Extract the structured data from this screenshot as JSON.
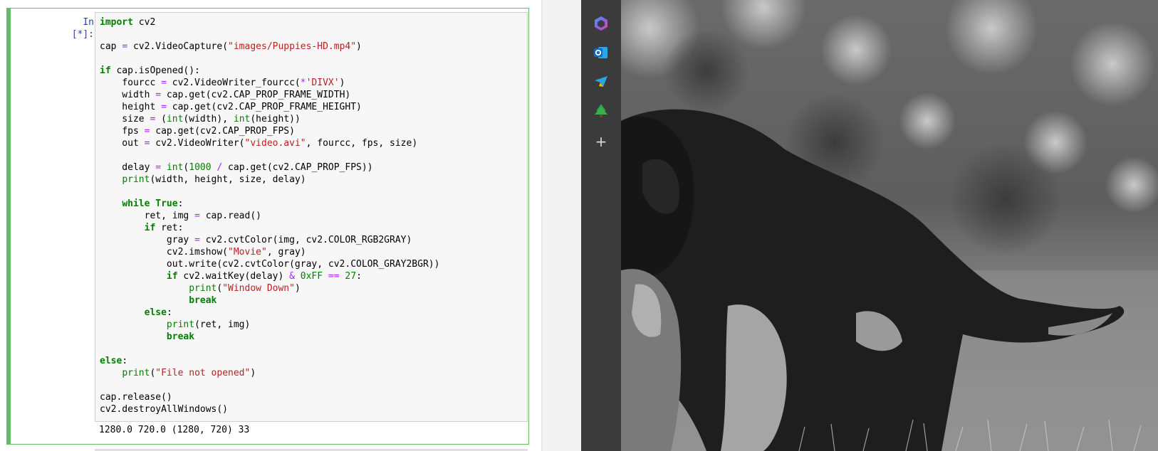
{
  "notebook": {
    "prompt": "In [*]:",
    "code_lines": [
      "import cv2",
      "",
      "cap = cv2.VideoCapture(\"images/Puppies-HD.mp4\")",
      "",
      "if cap.isOpened():",
      "    fourcc = cv2.VideoWriter_fourcc(*'DIVX')",
      "    width = cap.get(cv2.CAP_PROP_FRAME_WIDTH)",
      "    height = cap.get(cv2.CAP_PROP_FRAME_HEIGHT)",
      "    size = (int(width), int(height))",
      "    fps = cap.get(cv2.CAP_PROP_FPS)",
      "    out = cv2.VideoWriter(\"video.avi\", fourcc, fps, size)",
      "",
      "    delay = int(1000 / cap.get(cv2.CAP_PROP_FPS))",
      "    print(width, height, size, delay)",
      "",
      "    while True:",
      "        ret, img = cap.read()",
      "        if ret:",
      "            gray = cv2.cvtColor(img, cv2.COLOR_RGB2GRAY)",
      "            cv2.imshow(\"Movie\", gray)",
      "            out.write(cv2.cvtColor(gray, cv2.COLOR_GRAY2BGR))",
      "            if cv2.waitKey(delay) & 0xFF == 27:",
      "                print(\"Window Down\")",
      "                break",
      "        else:",
      "            print(ret, img)",
      "            break",
      "",
      "else:",
      "    print(\"File not opened\")",
      "",
      "cap.release()",
      "cv2.destroyAllWindows()"
    ],
    "output": "1280.0 720.0 (1280, 720) 33"
  },
  "edge_sidebar": {
    "icons": [
      "copilot-icon",
      "outlook-icon",
      "telegram-icon",
      "tree-icon",
      "add-icon"
    ],
    "add_label": "+"
  },
  "video_window": {
    "description_icon": "grayscale-puppy-frame"
  },
  "colors": {
    "cell_border": "#66bb6a",
    "prompt": "#303f9f",
    "keyword": "#008000",
    "string": "#ba2121",
    "operator": "#aa22ff",
    "sidebar_bg": "#3b3b3b"
  }
}
